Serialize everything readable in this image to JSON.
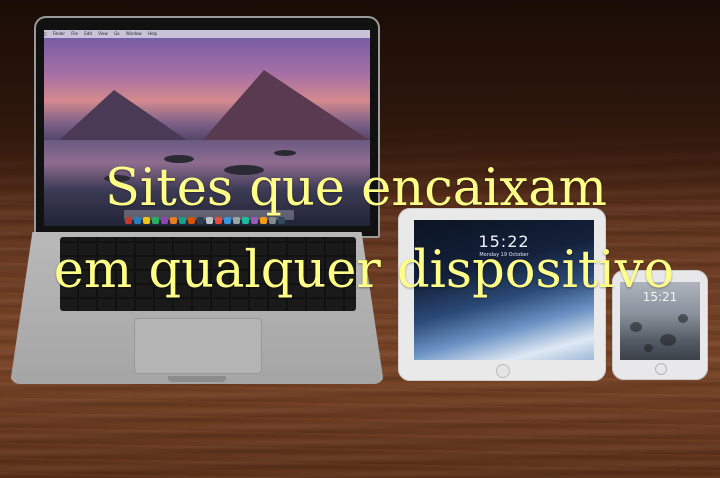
{
  "overlay": {
    "line1": "Sites que encaixam",
    "line2": "em qualquer dispositivo",
    "text_color": "#FFFF88"
  },
  "laptop": {
    "menubar": [
      "Finder",
      "File",
      "Edit",
      "View",
      "Go",
      "Window",
      "Help"
    ]
  },
  "ipad": {
    "time": "15:22",
    "date": "Monday 19 October"
  },
  "iphone": {
    "time": "15:21"
  }
}
